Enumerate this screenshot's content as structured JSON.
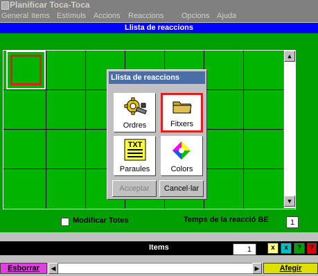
{
  "window": {
    "title": "Planificar Toca-Toca"
  },
  "menu": [
    "General",
    "Items",
    "Estímuls",
    "Accions",
    "Reaccions",
    "Opcions",
    "Ajuda"
  ],
  "header": {
    "title": "Llista de reaccions"
  },
  "dialog": {
    "title": "Llista de reaccions",
    "buttons": [
      {
        "label": "Ordres",
        "icon": "wrench-gear-icon"
      },
      {
        "label": "Fitxers",
        "icon": "folder-icon",
        "selected": true
      },
      {
        "label": "Paraules",
        "icon": "txt-document-icon"
      },
      {
        "label": "Colors",
        "icon": "color-wheel-icon"
      }
    ],
    "accept_label": "Acceptar",
    "cancel_label": "Cancel·lar"
  },
  "options": {
    "modify_all_label": "Modificar Totes",
    "modify_all_checked": false,
    "reaction_time_label": "Temps de la reacció BE",
    "reaction_time_value": "1"
  },
  "items_bar": {
    "title": "Items",
    "count": "1",
    "squares": [
      {
        "label": "x",
        "color": "#ffff80"
      },
      {
        "label": "x",
        "color": "#00c0c0"
      },
      {
        "label": "?",
        "color": "#00a000"
      },
      {
        "label": "?",
        "color": "#e00000"
      }
    ]
  },
  "bottom": {
    "delete_label": "Esborrar",
    "add_label": "Afegir"
  },
  "colors": {
    "accent_blue": "#0000ff",
    "grid_green": "#00b400",
    "selection_red": "#e02020"
  }
}
